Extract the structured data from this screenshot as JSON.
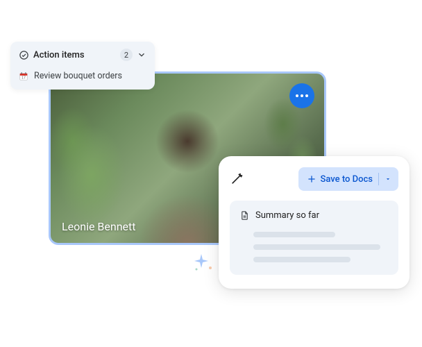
{
  "video": {
    "participant_name": "Leonie Bennett"
  },
  "action_items": {
    "title": "Action items",
    "count": "2",
    "items": [
      {
        "icon": "calendar",
        "text": "Review bouquet orders"
      }
    ]
  },
  "summary": {
    "save_label": "Save to Docs",
    "title": "Summary so far"
  },
  "colors": {
    "accent_blue": "#1a73e8",
    "chip_blue": "#d3e3fd",
    "chip_text": "#0b57d0",
    "panel_bg": "#f0f4f9",
    "tile_border": "#a8c7fa"
  }
}
